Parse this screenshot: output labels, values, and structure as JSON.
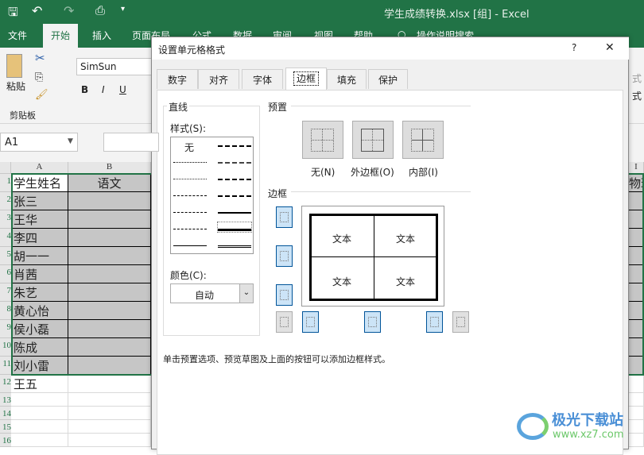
{
  "window": {
    "title": "学生成绩转换.xlsx [组] - Excel",
    "qat": [
      "save-icon",
      "undo-icon",
      "redo-icon",
      "print-preview-icon",
      "customize-icon"
    ]
  },
  "ribbon": {
    "tabs": [
      "文件",
      "开始",
      "插入",
      "页面布局",
      "公式",
      "数据",
      "审阅",
      "视图",
      "帮助",
      "操作说明搜索"
    ],
    "active_tab": "开始",
    "paste_label": "粘贴",
    "clipboard_label": "剪贴板",
    "font_name": "SimSun",
    "bold": "B",
    "italic": "I",
    "underline": "U",
    "right_partial_1": "式",
    "right_partial_2": "式"
  },
  "formula_bar": {
    "name_box": "A1",
    "cancel": "✕",
    "enter": "✓"
  },
  "sheet": {
    "columns": [
      "A",
      "B",
      "I"
    ],
    "rows": [
      "1",
      "2",
      "3",
      "4",
      "5",
      "6",
      "7",
      "8",
      "9",
      "10",
      "11",
      "12",
      "13",
      "14",
      "15",
      "16"
    ],
    "col_a": [
      "学生姓名",
      "张三",
      "王华",
      "李四",
      "胡一一",
      "肖茜",
      "朱艺",
      "黄心怡",
      "侯小磊",
      "陈成",
      "刘小雷",
      "王五"
    ],
    "col_b_header": "语文",
    "col_i_header": "物理"
  },
  "dialog": {
    "title": "设置单元格格式",
    "help": "?",
    "close": "✕",
    "tabs": [
      "数字",
      "对齐",
      "字体",
      "边框",
      "填充",
      "保护"
    ],
    "active_tab": "边框",
    "line_group": "直线",
    "style_label": "样式(S):",
    "style_none": "无",
    "color_label": "颜色(C):",
    "color_value": "自动",
    "preset_group": "预置",
    "presets": [
      "无(N)",
      "外边框(O)",
      "内部(I)"
    ],
    "border_group": "边框",
    "preview_text": [
      "文本",
      "文本",
      "文本",
      "文本"
    ],
    "hint": "单击预置选项、预览草图及上面的按钮可以添加边框样式。"
  },
  "watermark": {
    "name": "极光下载站",
    "url": "www.xz7.com"
  },
  "colors": {
    "excel_green": "#217346",
    "selected_fill": "#c6c6c6",
    "toggle_on": "#cce4f7"
  }
}
